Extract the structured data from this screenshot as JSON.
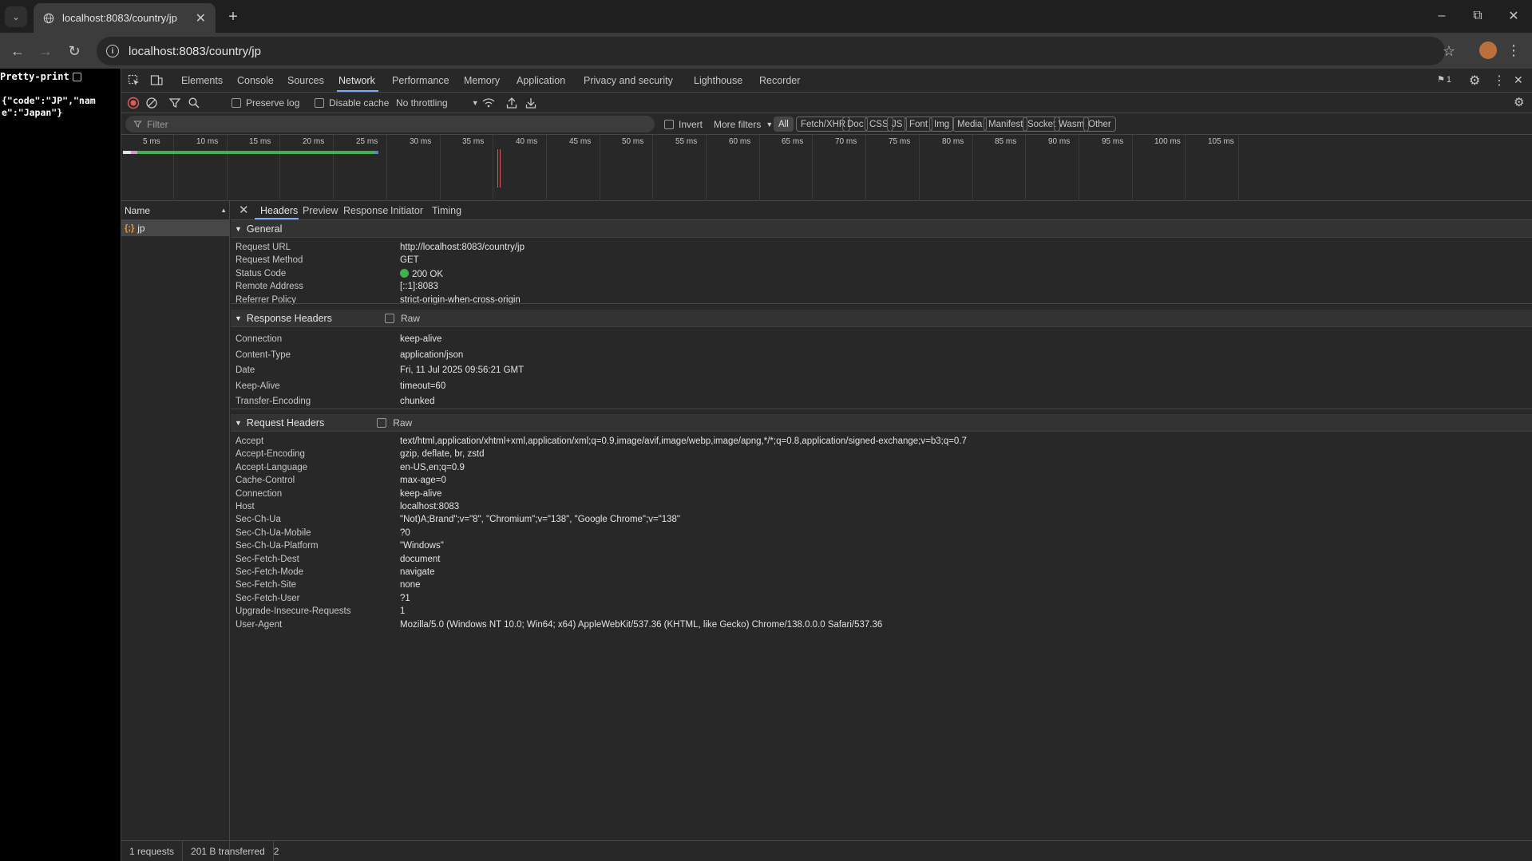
{
  "browser": {
    "tab_title": "localhost:8083/country/jp",
    "url": "localhost:8083/country/jp"
  },
  "page": {
    "pretty_print_label": "Pretty-print",
    "json_text": "{\"code\":\"JP\",\"name\":\"Japan\"}"
  },
  "devtools": {
    "tabs": [
      "Elements",
      "Console",
      "Sources",
      "Network",
      "Performance",
      "Memory",
      "Application",
      "Privacy and security",
      "Lighthouse",
      "Recorder"
    ],
    "active_tab": "Network",
    "issues_count": "1",
    "toolbar": {
      "preserve_log": "Preserve log",
      "disable_cache": "Disable cache",
      "throttling": "No throttling"
    },
    "filter": {
      "placeholder": "Filter",
      "invert": "Invert",
      "more_filters": "More filters",
      "chips": [
        "All",
        "Fetch/XHR",
        "Doc",
        "CSS",
        "JS",
        "Font",
        "Img",
        "Media",
        "Manifest",
        "Socket",
        "Wasm",
        "Other"
      ],
      "active_chip": "All"
    },
    "timeline_ticks": [
      "5 ms",
      "10 ms",
      "15 ms",
      "20 ms",
      "25 ms",
      "30 ms",
      "35 ms",
      "40 ms",
      "45 ms",
      "50 ms",
      "55 ms",
      "60 ms",
      "65 ms",
      "70 ms",
      "75 ms",
      "80 ms",
      "85 ms",
      "90 ms",
      "95 ms",
      "100 ms",
      "105 ms"
    ],
    "request_list": {
      "header": "Name",
      "rows": [
        "jp"
      ]
    },
    "status_bar": {
      "requests": "1 requests",
      "transferred": "201 B transferred",
      "extra": "2"
    },
    "details": {
      "tabs": [
        "Headers",
        "Preview",
        "Response",
        "Initiator",
        "Timing"
      ],
      "active_tab": "Headers",
      "general": {
        "title": "General",
        "rows": [
          {
            "key": "Request URL",
            "value": "http://localhost:8083/country/jp"
          },
          {
            "key": "Request Method",
            "value": "GET"
          },
          {
            "key": "Status Code",
            "value": "200 OK"
          },
          {
            "key": "Remote Address",
            "value": "[::1]:8083"
          },
          {
            "key": "Referrer Policy",
            "value": "strict-origin-when-cross-origin"
          }
        ]
      },
      "response_headers": {
        "title": "Response Headers",
        "raw_label": "Raw",
        "rows": [
          {
            "key": "Connection",
            "value": "keep-alive"
          },
          {
            "key": "Content-Type",
            "value": "application/json"
          },
          {
            "key": "Date",
            "value": "Fri, 11 Jul 2025 09:56:21 GMT"
          },
          {
            "key": "Keep-Alive",
            "value": "timeout=60"
          },
          {
            "key": "Transfer-Encoding",
            "value": "chunked"
          }
        ]
      },
      "request_headers": {
        "title": "Request Headers",
        "raw_label": "Raw",
        "rows": [
          {
            "key": "Accept",
            "value": "text/html,application/xhtml+xml,application/xml;q=0.9,image/avif,image/webp,image/apng,*/*;q=0.8,application/signed-exchange;v=b3;q=0.7"
          },
          {
            "key": "Accept-Encoding",
            "value": "gzip, deflate, br, zstd"
          },
          {
            "key": "Accept-Language",
            "value": "en-US,en;q=0.9"
          },
          {
            "key": "Cache-Control",
            "value": "max-age=0"
          },
          {
            "key": "Connection",
            "value": "keep-alive"
          },
          {
            "key": "Host",
            "value": "localhost:8083"
          },
          {
            "key": "Sec-Ch-Ua",
            "value": "\"Not)A;Brand\";v=\"8\", \"Chromium\";v=\"138\", \"Google Chrome\";v=\"138\""
          },
          {
            "key": "Sec-Ch-Ua-Mobile",
            "value": "?0"
          },
          {
            "key": "Sec-Ch-Ua-Platform",
            "value": "\"Windows\""
          },
          {
            "key": "Sec-Fetch-Dest",
            "value": "document"
          },
          {
            "key": "Sec-Fetch-Mode",
            "value": "navigate"
          },
          {
            "key": "Sec-Fetch-Site",
            "value": "none"
          },
          {
            "key": "Sec-Fetch-User",
            "value": "?1"
          },
          {
            "key": "Upgrade-Insecure-Requests",
            "value": "1"
          },
          {
            "key": "User-Agent",
            "value": "Mozilla/5.0 (Windows NT 10.0; Win64; x64) AppleWebKit/537.36 (KHTML, like Gecko) Chrome/138.0.0.0 Safari/537.36"
          }
        ]
      }
    }
  },
  "colors": {
    "accent": "#7cacf8",
    "status_ok": "#3fb14f",
    "record_red": "#e05a5a"
  }
}
